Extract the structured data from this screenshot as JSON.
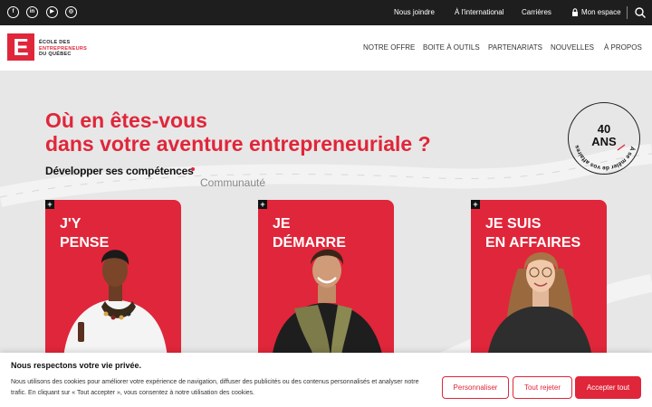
{
  "topbar": {
    "social": [
      {
        "name": "facebook-icon",
        "glyph": "f"
      },
      {
        "name": "linkedin-icon",
        "glyph": "in"
      },
      {
        "name": "youtube-icon",
        "glyph": "▶"
      },
      {
        "name": "instagram-icon",
        "glyph": "◎"
      }
    ],
    "links": [
      "Nous joindre",
      "À l'international",
      "Carrières"
    ],
    "account_label": "Mon espace"
  },
  "nav": {
    "logo_letter": "E",
    "logo_line1": "ÉCOLE DES",
    "logo_line2": "ENTREPRENEURS",
    "logo_line3": "DU QUÉBEC",
    "items": [
      "NOTRE OFFRE",
      "BOITE À OUTILS",
      "PARTENARIATS",
      "NOUVELLES",
      "À PROPOS"
    ]
  },
  "hero": {
    "heading_line1": "Où en êtes-vous",
    "heading_line2": "dans votre aventure entrepreneuriale ?",
    "tab_active": "Développer ses compétences",
    "tab_other": "Communauté",
    "badge_number": "40",
    "badge_unit": "ANS",
    "badge_ring_text": "À se mêler de vos affaires",
    "cards": [
      {
        "title_line1": "J'Y",
        "title_line2": "PENSE",
        "plus": "+"
      },
      {
        "title_line1": "JE",
        "title_line2": "DÉMARRE",
        "plus": "+"
      },
      {
        "title_line1": "JE SUIS",
        "title_line2": "EN AFFAIRES",
        "plus": "+"
      }
    ]
  },
  "cookie": {
    "title": "Nous respectons votre vie privée.",
    "text": "Nous utilisons des cookies pour améliorer votre expérience de navigation, diffuser des publicités ou des contenus personnalisés et analyser notre trafic. En cliquant sur « Tout accepter », vous consentez à notre utilisation des cookies.",
    "customize_label": "Personnaliser",
    "reject_label": "Tout rejeter",
    "accept_label": "Accepter tout"
  },
  "colors": {
    "brand": "#e0263a",
    "topbar": "#1e1e1e"
  }
}
